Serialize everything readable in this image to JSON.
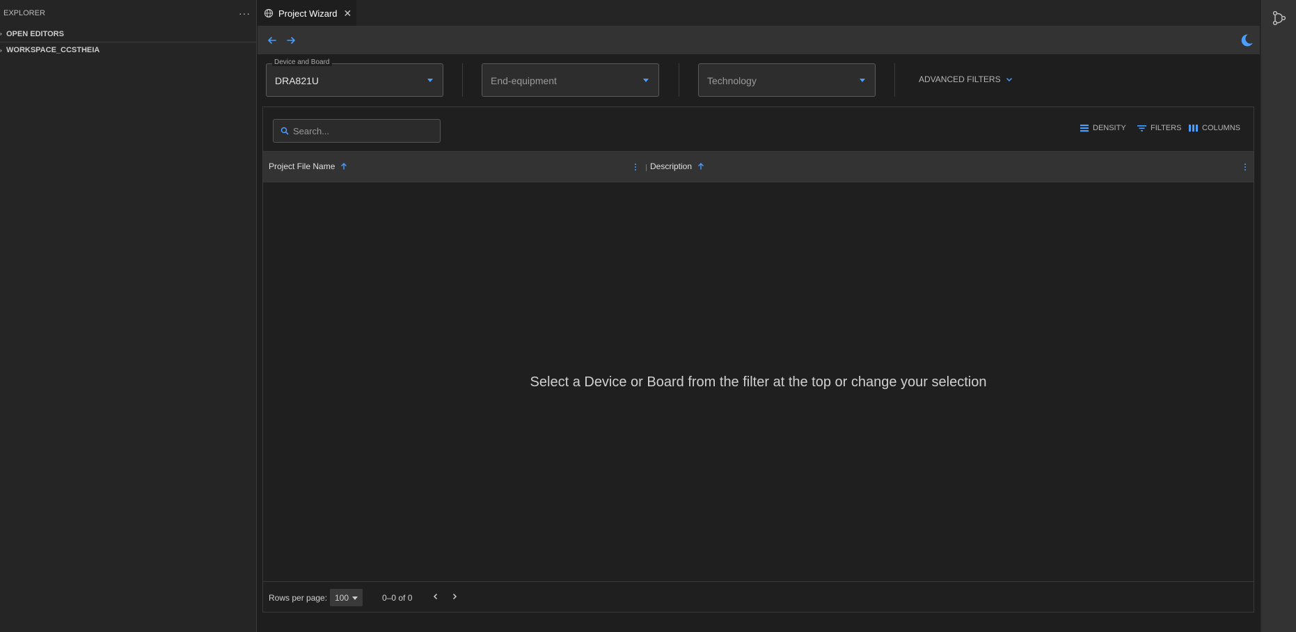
{
  "sidebar": {
    "title": "EXPLORER",
    "more": "···",
    "sections": [
      {
        "label": "OPEN EDITORS"
      },
      {
        "label": "WORKSPACE_CCSTHEIA"
      }
    ]
  },
  "tab": {
    "label": "Project Wizard",
    "close": "✕"
  },
  "filters": {
    "device": {
      "legend": "Device and Board",
      "value": "DRA821U"
    },
    "end_equipment": {
      "placeholder": "End-equipment"
    },
    "technology": {
      "placeholder": "Technology"
    },
    "advanced_label": "ADVANCED FILTERS"
  },
  "grid": {
    "search_placeholder": "Search...",
    "toolbar": {
      "density": "DENSITY",
      "filters": "FILTERS",
      "columns": "COLUMNS"
    },
    "columns": [
      {
        "label": "Project File Name"
      },
      {
        "label": "Description"
      }
    ],
    "empty_message": "Select a Device or Board from the filter at the top or change your selection",
    "footer": {
      "rows_per_page_label": "Rows per page:",
      "rows_per_page_value": "100",
      "range": "0–0 of 0"
    }
  },
  "colors": {
    "accent": "#4a9eff",
    "background": "#1e1e1e",
    "sidebar": "#252526",
    "toolbar": "#333333"
  }
}
